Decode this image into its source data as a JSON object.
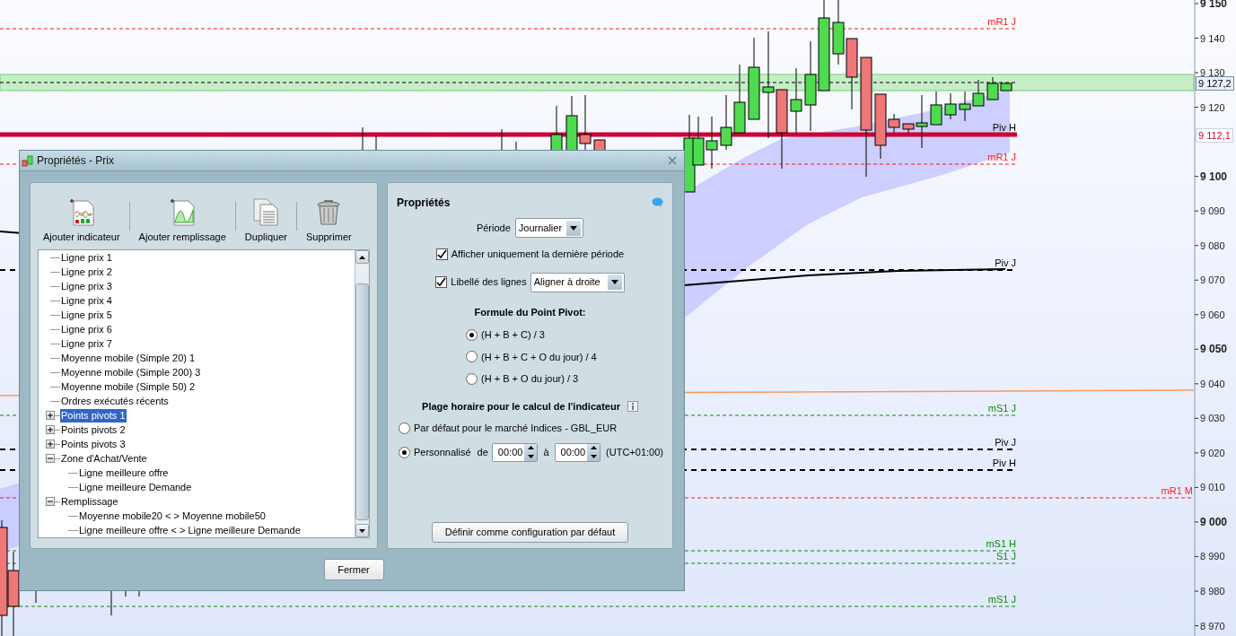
{
  "chart": {
    "axis_labels": [
      {
        "label": "9 150",
        "bold": true
      },
      {
        "label": "9 140",
        "bold": false
      },
      {
        "label": "9 130",
        "bold": false
      },
      {
        "label": "9 120",
        "bold": false
      },
      {
        "label": "9 100",
        "bold": true
      },
      {
        "label": "9 090",
        "bold": false
      },
      {
        "label": "9 080",
        "bold": false
      },
      {
        "label": "9 070",
        "bold": false
      },
      {
        "label": "9 060",
        "bold": false
      },
      {
        "label": "9 050",
        "bold": true
      },
      {
        "label": "9 040",
        "bold": false
      },
      {
        "label": "9 030",
        "bold": false
      },
      {
        "label": "9 020",
        "bold": false
      },
      {
        "label": "9 010",
        "bold": false
      },
      {
        "label": "9 000",
        "bold": true
      },
      {
        "label": "8 990",
        "bold": false
      },
      {
        "label": "8 980",
        "bold": false
      },
      {
        "label": "8 970",
        "bold": false
      }
    ],
    "price_tags": [
      {
        "label": "9 127,2",
        "kind": "last"
      },
      {
        "label": "9 112,1",
        "kind": "pivot"
      }
    ],
    "level_lines": [
      {
        "label": "mR1 J",
        "color": "#ff1a1a"
      },
      {
        "label": "Piv H",
        "color": "#000000"
      },
      {
        "label": "mR1 J",
        "color": "#ff1a1a"
      },
      {
        "label": "Piv J",
        "color": "#000000"
      },
      {
        "label": "mS1 J",
        "color": "#0a8a0a"
      },
      {
        "label": "Piv J",
        "color": "#000000"
      },
      {
        "label": "Piv H",
        "color": "#000000"
      },
      {
        "label": "mR1 M",
        "color": "#ff1a1a"
      },
      {
        "label": "mS1 H",
        "color": "#0a8a0a"
      },
      {
        "label": "S1 J",
        "color": "#0a8a0a"
      },
      {
        "label": "mS1 J",
        "color": "#0a8a0a"
      }
    ]
  },
  "dialog": {
    "title": "Propriétés - Prix",
    "toolbar": [
      "Ajouter indicateur",
      "Ajouter remplissage",
      "Dupliquer",
      "Supprimer"
    ],
    "tree": [
      {
        "label": "Ligne prix 1",
        "kind": "leaf",
        "selected": false
      },
      {
        "label": "Ligne prix 2",
        "kind": "leaf",
        "selected": false
      },
      {
        "label": "Ligne prix 3",
        "kind": "leaf",
        "selected": false
      },
      {
        "label": "Ligne prix 4",
        "kind": "leaf",
        "selected": false
      },
      {
        "label": "Ligne prix 5",
        "kind": "leaf",
        "selected": false
      },
      {
        "label": "Ligne prix 6",
        "kind": "leaf",
        "selected": false
      },
      {
        "label": "Ligne prix 7",
        "kind": "leaf",
        "selected": false
      },
      {
        "label": "Moyenne mobile (Simple 20) 1",
        "kind": "leaf",
        "selected": false
      },
      {
        "label": "Moyenne mobile (Simple 200) 3",
        "kind": "leaf",
        "selected": false
      },
      {
        "label": "Moyenne mobile (Simple 50) 2",
        "kind": "leaf",
        "selected": false
      },
      {
        "label": "Ordres exécutés récents",
        "kind": "leaf",
        "selected": false
      },
      {
        "label": "Points pivots 1",
        "kind": "group",
        "expanded": false,
        "selected": true
      },
      {
        "label": "Points pivots 2",
        "kind": "group",
        "expanded": false,
        "selected": false
      },
      {
        "label": "Points pivots 3",
        "kind": "group",
        "expanded": false,
        "selected": false
      },
      {
        "label": "Zone d'Achat/Vente",
        "kind": "group",
        "expanded": true,
        "selected": false,
        "children": [
          {
            "label": "Ligne meilleure offre",
            "kind": "leaf",
            "selected": false
          },
          {
            "label": "Ligne meilleure Demande",
            "kind": "leaf",
            "selected": false
          }
        ]
      },
      {
        "label": "Remplissage",
        "kind": "group",
        "expanded": true,
        "selected": false,
        "children": [
          {
            "label": "Moyenne mobile20 < > Moyenne mobile50",
            "kind": "leaf",
            "selected": false
          },
          {
            "label": "Ligne meilleure offre < > Ligne meilleure Demande",
            "kind": "leaf",
            "selected": false
          }
        ]
      }
    ],
    "properties": {
      "title": "Propriétés",
      "period": {
        "label": "Période",
        "value": "Journalier"
      },
      "last_period_only": {
        "label": "Afficher uniquement la dernière période",
        "checked": true
      },
      "line_labels": {
        "label": "Libellé des lignes",
        "checked": true,
        "value": "Aligner à droite"
      },
      "formula_title": "Formule du Point Pivot:",
      "formulas": [
        {
          "label": "(H + B + C) / 3",
          "selected": true
        },
        {
          "label": "(H + B + C + O du jour) / 4",
          "selected": false
        },
        {
          "label": "(H + B + O du jour) / 3",
          "selected": false
        }
      ],
      "range_title": "Plage horaire pour le calcul de l'indicateur",
      "range_default": {
        "label": "Par défaut pour le marché Indices - GBL_EUR",
        "selected": false
      },
      "range_custom": {
        "label": "Personnalisé",
        "selected": true,
        "from_label": "de",
        "from": "00:00",
        "to_label": "à",
        "to": "00:00",
        "timezone": "(UTC+01:00)"
      },
      "default_button": "Définir comme configuration par défaut"
    },
    "close_button": "Fermer"
  }
}
